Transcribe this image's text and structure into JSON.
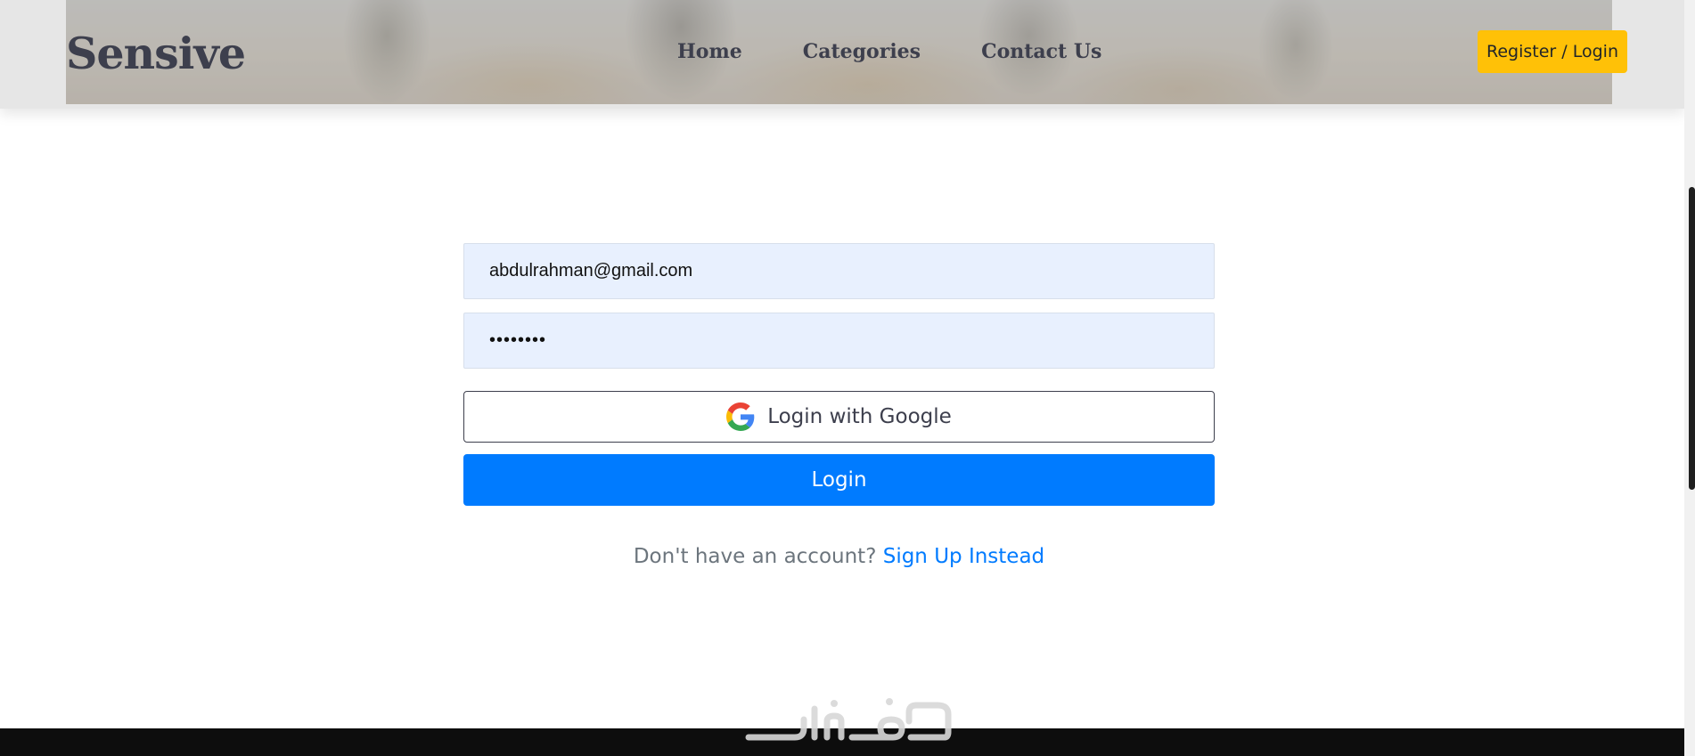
{
  "header": {
    "logo": "Sensive",
    "nav": [
      {
        "label": "Home"
      },
      {
        "label": "Categories"
      },
      {
        "label": "Contact Us"
      }
    ],
    "register_label": "Register / Login",
    "accent_color": "#ffc107"
  },
  "login_form": {
    "email_value": "abdulrahman@gmail.com",
    "password_value": "••••••••",
    "google_label": "Login with Google",
    "login_label": "Login",
    "signup_prompt": "Don't have an account?",
    "signup_link": "Sign Up Instead",
    "primary_color": "#007bff"
  },
  "watermark": {
    "text": "خمسات"
  },
  "icons": {
    "google": "google-logo-icon"
  }
}
